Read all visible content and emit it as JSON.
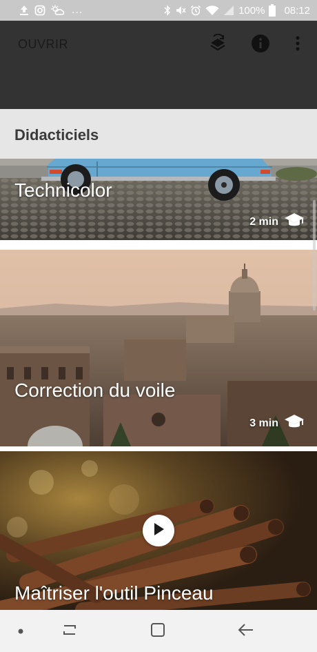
{
  "status_bar": {
    "left_icons": [
      "upload-icon",
      "instagram-icon",
      "weather-icon"
    ],
    "more": "...",
    "right_icons": [
      "bluetooth-icon",
      "mute-icon",
      "alarm-icon",
      "wifi-icon",
      "signal-icon"
    ],
    "battery_percent": "100%",
    "time": "08:12"
  },
  "app_bar": {
    "open_label": "OUVRIR",
    "actions": [
      "looks-history-icon",
      "info-icon",
      "more-vert-icon"
    ]
  },
  "section": {
    "title": "Didacticiels"
  },
  "tutorials": [
    {
      "title": "Technicolor",
      "duration": "2 min",
      "icon": "graduation-cap-icon"
    },
    {
      "title": "Correction du voile",
      "duration": "3 min",
      "icon": "graduation-cap-icon"
    },
    {
      "title": "Maîtriser l'outil Pinceau",
      "icon": "play-icon"
    }
  ],
  "nav_bar": {
    "items": [
      "dot-icon",
      "recents-icon",
      "home-icon",
      "back-icon"
    ]
  },
  "colors": {
    "status_bar": "#c8c8c8",
    "app_bar": "#333333",
    "section_header": "#e6e6e6",
    "nav_bar": "#f2f2f2",
    "card_text": "#ffffff"
  }
}
